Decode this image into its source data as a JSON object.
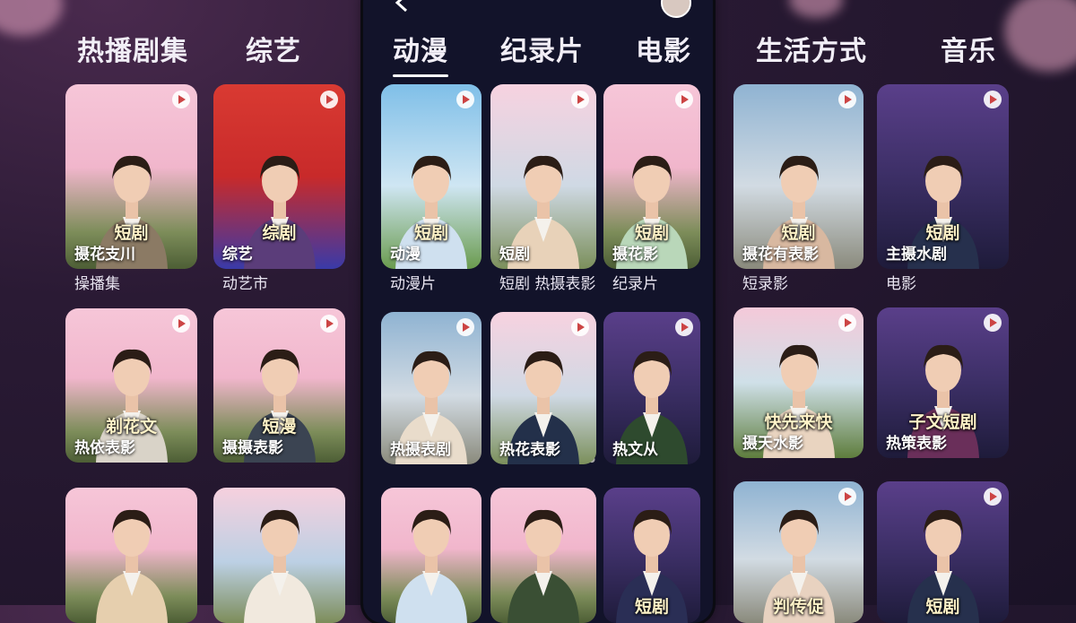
{
  "panels": {
    "left": {
      "tabs": [
        "热播剧集",
        "综艺"
      ],
      "cards": [
        {
          "badge": "短剧",
          "overlay": "摄花支川",
          "caption": "操播集",
          "scene": "blossom"
        },
        {
          "badge": "综剧",
          "overlay": "综艺",
          "caption": "动艺市",
          "scene": "studio"
        },
        {
          "badge": "",
          "overlay": "热依表影",
          "caption": "",
          "scene": "blossom",
          "mid_text": "剃花文"
        },
        {
          "badge": "短漫",
          "overlay": "摄摄表影",
          "caption": "",
          "scene": "blossom"
        },
        {
          "badge": "",
          "overlay": "",
          "caption": "",
          "scene": "blossom"
        },
        {
          "badge": "",
          "overlay": "",
          "caption": "",
          "scene": "mountain"
        }
      ]
    },
    "middle": {
      "tabs": [
        "动漫",
        "纪录片",
        "电影"
      ],
      "cards": [
        {
          "badge": "短剧",
          "overlay": "动漫",
          "caption": "动漫片",
          "scene": "anime"
        },
        {
          "badge": "",
          "overlay": "短剧",
          "caption": "短剧 热摄表影",
          "scene": "blossom-city"
        },
        {
          "badge": "短剧",
          "overlay": "摄花影",
          "caption": "纪录片",
          "scene": "blossom"
        },
        {
          "badge": "",
          "overlay": "热摄表剧",
          "caption": "",
          "scene": "city"
        },
        {
          "badge": "",
          "overlay": "热花表影",
          "caption": "",
          "scene": "blossom-city"
        },
        {
          "badge": "",
          "overlay": "热文从",
          "caption": "",
          "scene": "city-night"
        },
        {
          "badge": "",
          "overlay": "",
          "caption": "",
          "scene": "blossom"
        },
        {
          "badge": "",
          "overlay": "",
          "caption": "",
          "scene": "blossom"
        },
        {
          "badge": "短剧",
          "overlay": "",
          "caption": "",
          "scene": "city-night"
        }
      ]
    },
    "right": {
      "tabs": [
        "生活方式",
        "音乐"
      ],
      "cards": [
        {
          "badge": "短剧",
          "overlay": "摄花有表影",
          "caption": "短录影",
          "scene": "city"
        },
        {
          "badge": "短剧",
          "overlay": "主摄水剧",
          "caption": "电影",
          "scene": "city-night"
        },
        {
          "badge": "快先来快",
          "overlay": "摄天水影",
          "caption": "",
          "scene": "park"
        },
        {
          "badge": "子文短剧",
          "overlay": "热策表影",
          "caption": "",
          "scene": "city-night"
        },
        {
          "badge": "判传促",
          "overlay": "",
          "caption": "",
          "scene": "city"
        },
        {
          "badge": "短剧",
          "overlay": "",
          "caption": "",
          "scene": "city-night"
        }
      ]
    }
  },
  "colors": {
    "background": "#1a1226",
    "blossom": "#f2b8cf",
    "tab_text": "#f1eef6"
  },
  "icons": [
    "play-icon",
    "back-arrow-icon",
    "avatar-icon"
  ]
}
